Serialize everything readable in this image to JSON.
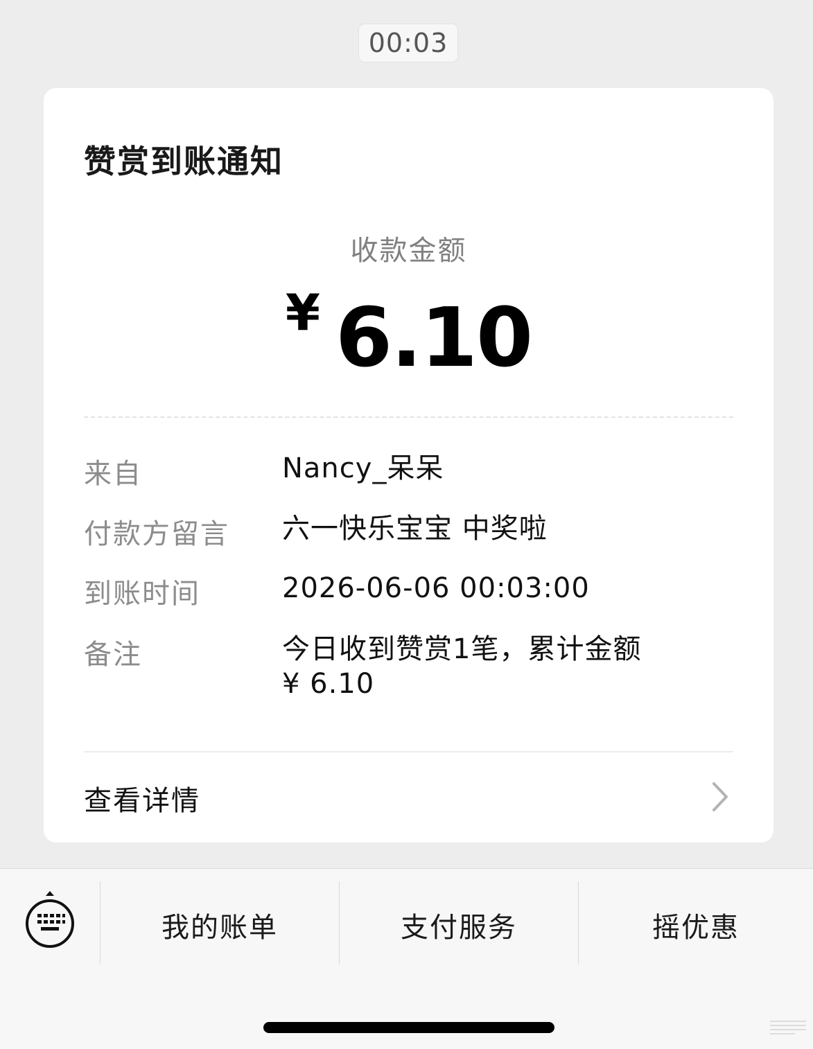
{
  "timestamp": "00:03",
  "card": {
    "title": "赞赏到账通知",
    "amount_label": "收款金额",
    "currency": "¥",
    "amount": "6.10",
    "rows": [
      {
        "label": "来自",
        "value": "Nancy_呆呆"
      },
      {
        "label": "付款方留言",
        "value": "六一快乐宝宝 中奖啦"
      },
      {
        "label": "到账时间",
        "value": "2026-06-06 00:03:00"
      },
      {
        "label": "备注",
        "value_line1": "今日收到赞赏1笔，累计金额",
        "value_line2": "¥ 6.10"
      }
    ],
    "detail_link": "查看详情"
  },
  "bottom_menu": {
    "items": [
      "我的账单",
      "支付服务",
      "摇优惠"
    ]
  },
  "icons": {
    "keyboard": "keyboard-icon",
    "chevron": "chevron-right-icon"
  }
}
